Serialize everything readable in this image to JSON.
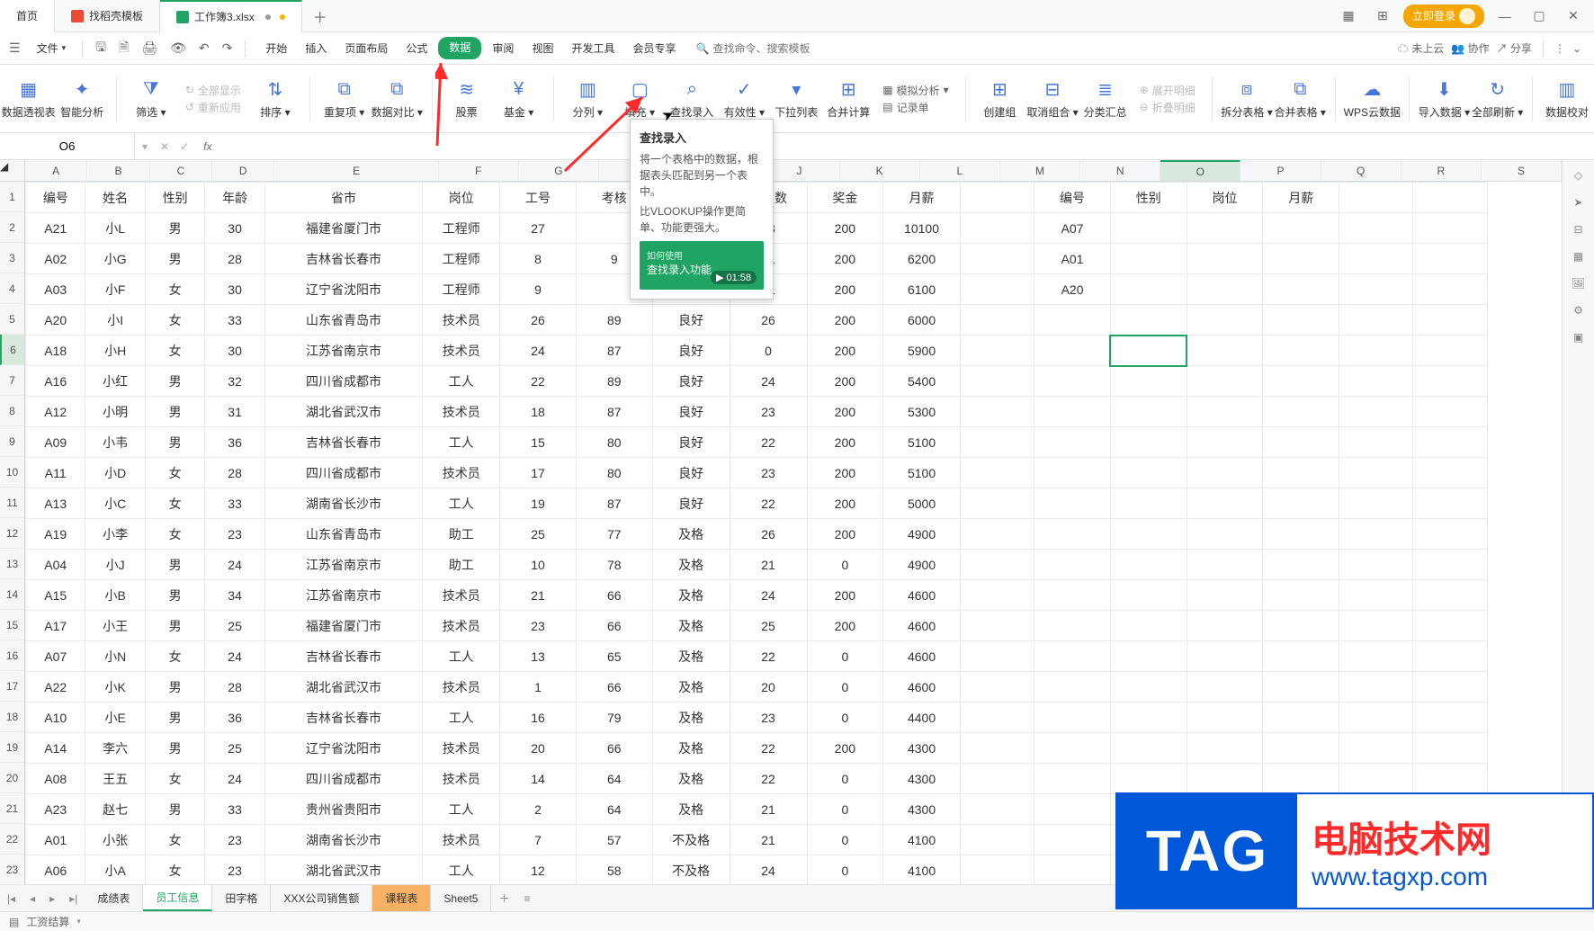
{
  "title_tabs": {
    "home": "首页",
    "template": "找稻壳模板",
    "file": "工作簿3.xlsx"
  },
  "window_controls": {
    "login": "立即登录"
  },
  "menubar": {
    "file": "文件",
    "tabs": [
      "开始",
      "插入",
      "页面布局",
      "公式",
      "数据",
      "审阅",
      "视图",
      "开发工具",
      "会员专享"
    ],
    "active_index": 4,
    "search_placeholder": "查找命令、搜索模板",
    "right": {
      "cloud": "未上云",
      "coop": "协作",
      "share": "分享"
    }
  },
  "ribbon": {
    "pivot": "数据透视表",
    "smart": "智能分析",
    "filter": "筛选",
    "showall": "全部显示",
    "reapply": "重新应用",
    "sort": "排序",
    "dup": "重复项",
    "compare": "数据对比",
    "stock": "股票",
    "fund": "基金",
    "split": "分列",
    "fill": "填充",
    "lookup": "查找录入",
    "valid": "有效性",
    "dropdown": "下拉列表",
    "merge": "合并计算",
    "sim": "模拟分析",
    "form": "记录单",
    "group": "创建组",
    "ungroup": "取消组合",
    "subtotal": "分类汇总",
    "expand": "展开明细",
    "collapse": "折叠明细",
    "splittable": "拆分表格",
    "mergetable": "合并表格",
    "wpscloud": "WPS云数据",
    "import": "导入数据",
    "refresh": "全部刷新",
    "dataval": "数据校对"
  },
  "tooltip": {
    "title": "查找录入",
    "l1": "将一个表格中的数据，根据表头匹配到另一个表中。",
    "l2": "比VLOOKUP操作更简单、功能更强大。",
    "v1": "如何使用",
    "v2": "查找录入功能",
    "dur": "01:58"
  },
  "cellref": "O6",
  "cols": {
    "widths": [
      70,
      70,
      70,
      70,
      184,
      90,
      90,
      90,
      90,
      90,
      90,
      90,
      90,
      90,
      90,
      90,
      90,
      90,
      90,
      90
    ],
    "letters": [
      "A",
      "B",
      "C",
      "D",
      "E",
      "F",
      "G",
      "H",
      "I",
      "J",
      "K",
      "L",
      "M",
      "N",
      "O",
      "P",
      "Q",
      "R",
      "S"
    ]
  },
  "headers_left": [
    "编号",
    "姓名",
    "性别",
    "年龄",
    "省市",
    "岗位",
    "工号",
    "考核",
    "",
    "勤天数",
    "奖金",
    "月薪"
  ],
  "headers_right": {
    "N": "编号",
    "O": "性别",
    "P": "岗位",
    "Q": "月薪"
  },
  "rows": [
    [
      "A21",
      "小L",
      "男",
      "30",
      "福建省厦门市",
      "工程师",
      "27",
      "",
      "",
      "28",
      "200",
      "10100"
    ],
    [
      "A02",
      "小G",
      "男",
      "28",
      "吉林省长春市",
      "工程师",
      "8",
      "9",
      "",
      "21",
      "200",
      "6200"
    ],
    [
      "A03",
      "小F",
      "女",
      "30",
      "辽宁省沈阳市",
      "工程师",
      "9",
      "",
      "",
      "21",
      "200",
      "6100"
    ],
    [
      "A20",
      "小I",
      "女",
      "33",
      "山东省青岛市",
      "技术员",
      "26",
      "89",
      "良好",
      "26",
      "200",
      "6000"
    ],
    [
      "A18",
      "小H",
      "女",
      "30",
      "江苏省南京市",
      "技术员",
      "24",
      "87",
      "良好",
      "0",
      "200",
      "5900"
    ],
    [
      "A16",
      "小红",
      "男",
      "32",
      "四川省成都市",
      "工人",
      "22",
      "89",
      "良好",
      "24",
      "200",
      "5400"
    ],
    [
      "A12",
      "小明",
      "男",
      "31",
      "湖北省武汉市",
      "技术员",
      "18",
      "87",
      "良好",
      "23",
      "200",
      "5300"
    ],
    [
      "A09",
      "小韦",
      "男",
      "36",
      "吉林省长春市",
      "工人",
      "15",
      "80",
      "良好",
      "22",
      "200",
      "5100"
    ],
    [
      "A11",
      "小D",
      "女",
      "28",
      "四川省成都市",
      "技术员",
      "17",
      "80",
      "良好",
      "23",
      "200",
      "5100"
    ],
    [
      "A13",
      "小C",
      "女",
      "33",
      "湖南省长沙市",
      "工人",
      "19",
      "87",
      "良好",
      "22",
      "200",
      "5000"
    ],
    [
      "A19",
      "小李",
      "女",
      "23",
      "山东省青岛市",
      "助工",
      "25",
      "77",
      "及格",
      "26",
      "200",
      "4900"
    ],
    [
      "A04",
      "小J",
      "男",
      "24",
      "江苏省南京市",
      "助工",
      "10",
      "78",
      "及格",
      "21",
      "0",
      "4900"
    ],
    [
      "A15",
      "小B",
      "男",
      "34",
      "江苏省南京市",
      "技术员",
      "21",
      "66",
      "及格",
      "24",
      "200",
      "4600"
    ],
    [
      "A17",
      "小王",
      "男",
      "25",
      "福建省厦门市",
      "技术员",
      "23",
      "66",
      "及格",
      "25",
      "200",
      "4600"
    ],
    [
      "A07",
      "小N",
      "女",
      "24",
      "吉林省长春市",
      "工人",
      "13",
      "65",
      "及格",
      "22",
      "0",
      "4600"
    ],
    [
      "A22",
      "小K",
      "男",
      "28",
      "湖北省武汉市",
      "技术员",
      "1",
      "66",
      "及格",
      "20",
      "0",
      "4600"
    ],
    [
      "A10",
      "小E",
      "男",
      "36",
      "吉林省长春市",
      "工人",
      "16",
      "79",
      "及格",
      "23",
      "0",
      "4400"
    ],
    [
      "A14",
      "李六",
      "男",
      "25",
      "辽宁省沈阳市",
      "技术员",
      "20",
      "66",
      "及格",
      "22",
      "200",
      "4300"
    ],
    [
      "A08",
      "王五",
      "女",
      "24",
      "四川省成都市",
      "技术员",
      "14",
      "64",
      "及格",
      "22",
      "0",
      "4300"
    ],
    [
      "A23",
      "赵七",
      "男",
      "33",
      "贵州省贵阳市",
      "工人",
      "2",
      "64",
      "及格",
      "21",
      "0",
      "4300"
    ],
    [
      "A01",
      "小张",
      "女",
      "23",
      "湖南省长沙市",
      "技术员",
      "7",
      "57",
      "不及格",
      "21",
      "0",
      "4100"
    ],
    [
      "A06",
      "小A",
      "女",
      "23",
      "湖北省武汉市",
      "工人",
      "12",
      "58",
      "不及格",
      "24",
      "0",
      "4100"
    ]
  ],
  "right_col_N": [
    "A07",
    "A01",
    "A20"
  ],
  "sheets": {
    "list": [
      "成绩表",
      "员工信息",
      "田字格",
      "XXX公司销售额",
      "课程表",
      "Sheet5"
    ],
    "active": 1,
    "orange": 4
  },
  "statusbar": {
    "calc": "工资结算"
  },
  "logo": {
    "tag": "TAG",
    "cn": "电脑技术网",
    "url": "www.tagxp.com"
  }
}
